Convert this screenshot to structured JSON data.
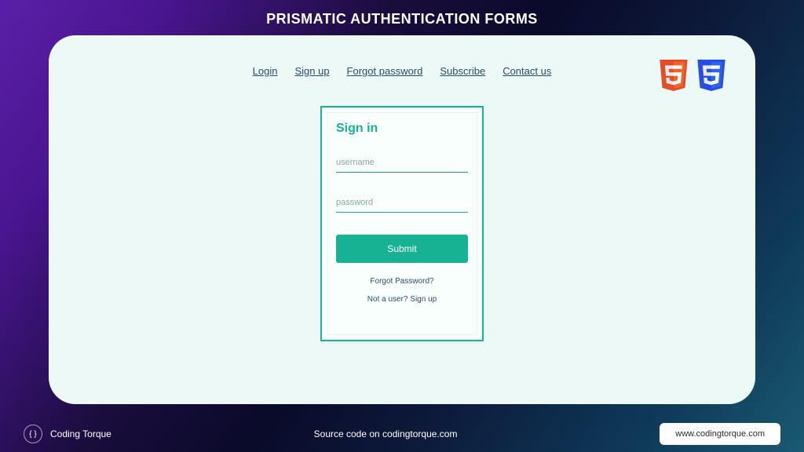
{
  "page_title": "PRISMATIC AUTHENTICATION FORMS",
  "nav": {
    "items": [
      {
        "label": "Login"
      },
      {
        "label": "Sign up"
      },
      {
        "label": "Forgot password"
      },
      {
        "label": "Subscribe"
      },
      {
        "label": "Contact us"
      }
    ]
  },
  "signin": {
    "title": "Sign in",
    "username_placeholder": "username",
    "password_placeholder": "password",
    "submit_label": "Submit",
    "forgot_label": "Forgot Password?",
    "signup_label": "Not a user? Sign up"
  },
  "footer": {
    "brand": "Coding Torque",
    "center_text": "Source code on codingtorque.com",
    "url": "www.codingtorque.com"
  },
  "colors": {
    "accent": "#17B294",
    "link": "#2a4b6f",
    "card_bg": "#edf9f7"
  }
}
